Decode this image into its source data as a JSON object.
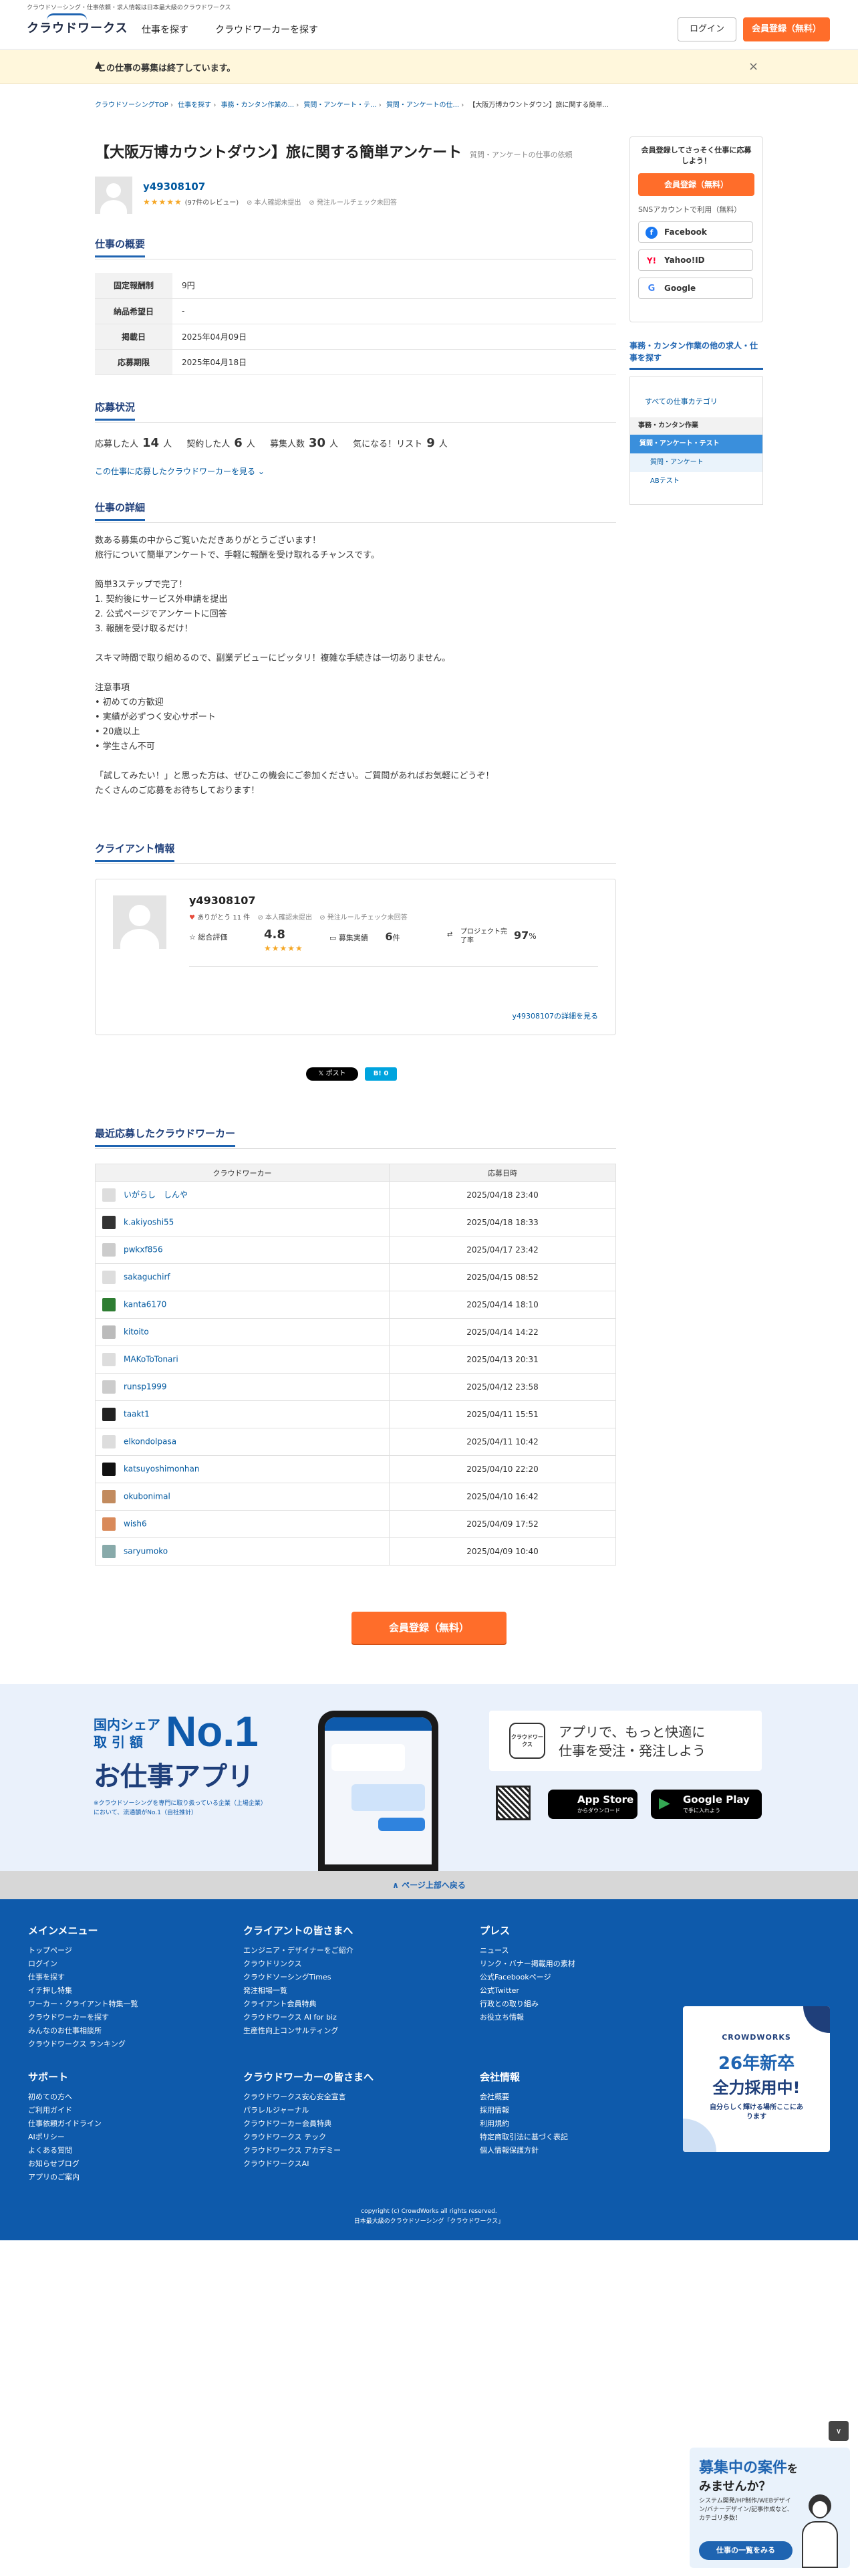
{
  "header": {
    "tagline": "クラウドソーシング・仕事依頼・求人情報は日本最大級のクラウドワークス",
    "logo": "クラウドワークス",
    "nav": [
      "仕事を探す",
      "クラウドワーカーを探す"
    ],
    "login": "ログイン",
    "register": "会員登録（無料）"
  },
  "notice": {
    "text": "この仕事の募集は終了しています。",
    "close": "×"
  },
  "breadcrumb": [
    "クラウドソーシングTOP",
    "仕事を探す",
    "事務・カンタン作業の...",
    "質問・アンケート・テ...",
    "質問・アンケートの仕...",
    "【大阪万博カウントダウン】旅に関する簡単..."
  ],
  "job": {
    "title": "【大阪万博カウントダウン】旅に関する簡単アンケート",
    "category": "質問・アンケートの仕事の依頼",
    "client_name": "y49308107",
    "stars": "★★★★★",
    "reviews": "(97件のレビュー)",
    "badge1": "本人確認未提出",
    "badge2": "発注ルールチェック未回答"
  },
  "overview": {
    "heading": "仕事の概要",
    "rows": [
      {
        "k": "固定報酬制",
        "v": "9円"
      },
      {
        "k": "納品希望日",
        "v": "-"
      },
      {
        "k": "掲載日",
        "v": "2025年04月09日"
      },
      {
        "k": "応募期限",
        "v": "2025年04月18日"
      }
    ]
  },
  "status": {
    "heading": "応募状況",
    "items": [
      {
        "label": "応募した人",
        "value": "14",
        "unit": "人"
      },
      {
        "label": "契約した人",
        "value": "6",
        "unit": "人"
      },
      {
        "label": "募集人数",
        "value": "30",
        "unit": "人"
      },
      {
        "label": "気になる！リスト",
        "value": "9",
        "unit": "人"
      }
    ],
    "link": "この仕事に応募したクラウドワーカーを見る"
  },
  "detail": {
    "heading": "仕事の詳細",
    "body": "数ある募集の中からご覧いただきありがとうございます！\n旅行について簡単アンケートで、手軽に報酬を受け取れるチャンスです。\n\n簡単3ステップで完了！\n1. 契約後にサービス外申請を提出\n2. 公式ページでアンケートに回答\n3. 報酬を受け取るだけ！\n\nスキマ時間で取り組めるので、副業デビューにピッタリ！複雑な手続きは一切ありません。\n\n注意事項\n• 初めての方歓迎\n• 実績が必ずつく安心サポート\n• 20歳以上\n• 学生さん不可\n\n「試してみたい！」と思った方は、ぜひこの機会にご参加ください。ご質問があればお気軽にどうぞ！\nたくさんのご応募をお待ちしております！"
  },
  "client": {
    "heading": "クライアント情報",
    "name": "y49308107",
    "thanks": "ありがとう 11 件",
    "badge1": "本人確認未提出",
    "badge2": "発注ルールチェック未回答",
    "rating_label": "総合評価",
    "rating": "4.8",
    "stars": "★★★★★",
    "jobs_label": "募集実績",
    "jobs": "6",
    "jobs_unit": "件",
    "completion_label": "プロジェクト完了率",
    "completion": "97",
    "completion_unit": "%",
    "more": "y49308107の詳細を見る"
  },
  "share": {
    "post": "ポスト",
    "hatena": "B! 0"
  },
  "applicants": {
    "heading": "最近応募したクラウドワーカー",
    "col1": "クラウドワーカー",
    "col2": "応募日時",
    "rows": [
      {
        "name": "いがらし　しんや",
        "date": "2025/04/18 23:40"
      },
      {
        "name": "k.akiyoshi55",
        "date": "2025/04/18 18:33"
      },
      {
        "name": "pwkxf856",
        "date": "2025/04/17 23:42"
      },
      {
        "name": "sakaguchirf",
        "date": "2025/04/15 08:52"
      },
      {
        "name": "kanta6170",
        "date": "2025/04/14 18:10"
      },
      {
        "name": "kitoito",
        "date": "2025/04/14 14:22"
      },
      {
        "name": "MAKoToTonari",
        "date": "2025/04/13 20:31"
      },
      {
        "name": "runsp1999",
        "date": "2025/04/12 23:58"
      },
      {
        "name": "taakt1",
        "date": "2025/04/11 15:51"
      },
      {
        "name": "elkondolpasa",
        "date": "2025/04/11 10:42"
      },
      {
        "name": "katsuyoshimonhan",
        "date": "2025/04/10 22:20"
      },
      {
        "name": "okubonimal",
        "date": "2025/04/10 16:42"
      },
      {
        "name": "wish6",
        "date": "2025/04/09 17:52"
      },
      {
        "name": "saryumoko",
        "date": "2025/04/09 10:40"
      }
    ]
  },
  "cta": "会員登録（無料）",
  "sidebar": {
    "lead": "会員登録してさっそく仕事に応募しよう！",
    "register": "会員登録（無料）",
    "sns_label": "SNSアカウントで利用（無料）",
    "facebook": "Facebook",
    "yahoo": "Yahoo!ID",
    "google": "Google",
    "cat_heading": "事務・カンタン作業の他の求人・仕事を探す",
    "all": "すべての仕事カテゴリ",
    "cat1": "事務・カンタン作業",
    "cat2": "質問・アンケート・テスト",
    "cat3": "質問・アンケート",
    "cat4": "ABテスト"
  },
  "app": {
    "share1": "国内シェア",
    "share2": "取 引 額",
    "no1": "No.1",
    "title": "お仕事アプリ",
    "note": "※クラウドソーシングを専門に取り扱っている企業（上場企業）において、流通額がNo.1（自社推計）",
    "logo": "クラウドワークス",
    "lead1": "アプリで、もっと快適に",
    "lead2": "仕事を受注・発注しよう",
    "appstore": "App Store",
    "appstore_sub": "からダウンロード",
    "gplay": "Google Play",
    "gplay_sub": "で手に入れよう"
  },
  "pagetop": "∧ ページ上部へ戻る",
  "footer": {
    "col1_h": "メインメニュー",
    "col1": [
      "トップページ",
      "ログイン",
      "仕事を探す",
      "イチ押し特集",
      "ワーカー・クライアント特集一覧",
      "クラウドワーカーを探す",
      "みんなのお仕事相談所",
      "クラウドワークス ランキング"
    ],
    "col1b_h": "サポート",
    "col1b": [
      "初めての方へ",
      "ご利用ガイド",
      "仕事依頼ガイドライン",
      "AIポリシー",
      "よくある質問",
      "お知らせブログ",
      "アプリのご案内"
    ],
    "col2_h": "クライアントの皆さまへ",
    "col2": [
      "エンジニア・デザイナーをご紹介",
      "クラウドリンクス",
      "クラウドソーシングTimes",
      "発注相場一覧",
      "クライアント会員特典",
      "クラウドワークス AI for biz",
      "生産性向上コンサルティング"
    ],
    "col2b_h": "クラウドワーカーの皆さまへ",
    "col2b": [
      "クラウドワークス安心安全宣言",
      "パラレルジャーナル",
      "クラウドワーカー会員特典",
      "クラウドワークス テック",
      "クラウドワークス アカデミー",
      "クラウドワークスAI"
    ],
    "col3_h": "プレス",
    "col3": [
      "ニュース",
      "リンク・バナー掲載用の素材",
      "公式Facebookページ",
      "公式Twitter",
      "行政との取り組み",
      "お役立ち情報"
    ],
    "col3b_h": "会社情報",
    "col3b": [
      "会社概要",
      "採用情報",
      "利用規約",
      "特定商取引法に基づく表記",
      "個人情報保護方針"
    ],
    "banner_brand": "CROWDWORKS",
    "banner_title1": "26年新卒",
    "banner_title2": "全力採用中!",
    "banner_sub": "自分らしく輝ける場所ここにあります",
    "copyright": "copyright (c) CrowdWorks all rights reserved.",
    "copyright2": "日本最大級のクラウドソーシング「クラウドワークス」"
  },
  "float_banner": {
    "title1": "募集中の案件",
    "title2": "を",
    "title3": "みませんか？",
    "body": "システム開発/HP制作/WEBデザイン/バナーデザイン/記事作成など、カテゴリ多数！",
    "button": "仕事の一覧をみる"
  },
  "colors": {
    "brand": "#0e5aab",
    "accent": "#ff6d2a",
    "star": "#f5a623"
  }
}
